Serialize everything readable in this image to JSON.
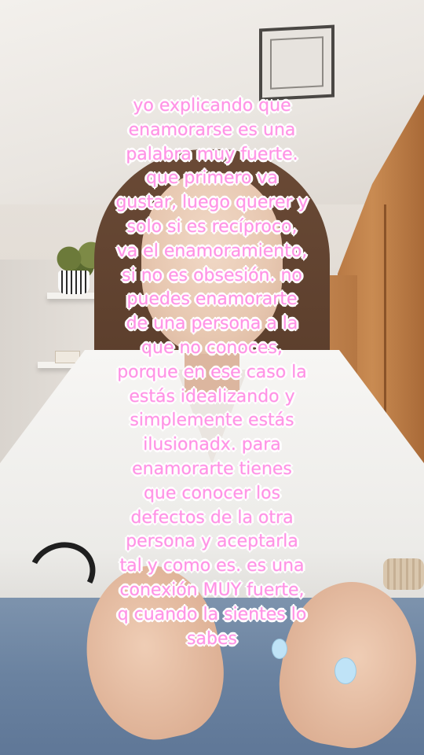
{
  "caption": {
    "lines": [
      "yo explicando que",
      "enamorarse es una",
      "palabra muy fuerte.",
      "que primero va",
      "gustar, luego querer y",
      "solo si es recíproco,",
      "va el enamoramiento,",
      "si no es obsesión. no",
      "puedes enamorarte",
      "de una persona a la",
      "que no conoces,",
      "porque en ese caso la",
      "estás idealizando y",
      "simplemente estás",
      "ilusionadx. para",
      "enamorarte tienes",
      "que conocer los",
      "defectos de la otra",
      "persona y aceptarla",
      "tal y como es. es una",
      "conexión MUY fuerte,",
      "q cuando la sientes lo",
      "sabes"
    ],
    "text_color": "#ff8fe4",
    "outline_color": "#ffffff"
  },
  "scene": {
    "wardrobe_color": "#c98b52",
    "shirt_color": "#f7f6f4",
    "jeans_color": "#6a82a0",
    "nail_color": "#bfe3f7"
  }
}
